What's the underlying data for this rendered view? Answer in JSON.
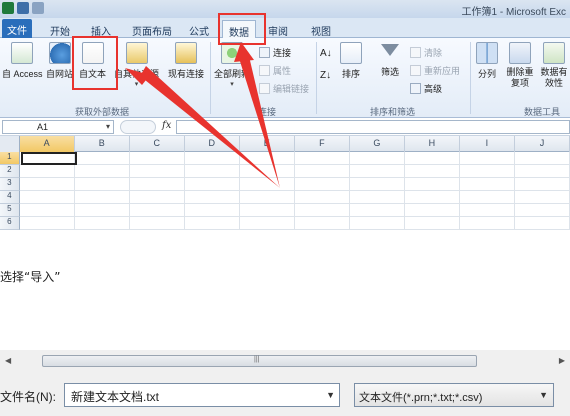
{
  "window": {
    "title": "工作簿1 - Microsoft Exc"
  },
  "tabs": {
    "file": "文件",
    "items": [
      "开始",
      "插入",
      "页面布局",
      "公式",
      "数据",
      "审阅",
      "视图"
    ],
    "active": "数据"
  },
  "ribbon": {
    "get_external": {
      "access": "自 Access",
      "web": "自网站",
      "text": "自文本",
      "other": "自其他来源",
      "existing": "现有连接",
      "label": "获取外部数据"
    },
    "connections": {
      "refresh_all": "全部刷新",
      "connections": "连接",
      "properties": "属性",
      "edit_links": "编辑链接",
      "label": "连接"
    },
    "sort_filter": {
      "sort": "排序",
      "filter": "筛选",
      "clear": "清除",
      "reapply": "重新应用",
      "advanced": "高级",
      "label": "排序和筛选"
    },
    "data_tools": {
      "split": "分列",
      "remove_dup": "删除重复项",
      "validation": "数据有效性",
      "label": "数据工具"
    }
  },
  "formula_bar": {
    "name_box": "A1",
    "fx": "fx",
    "content": ""
  },
  "grid": {
    "columns": [
      "A",
      "B",
      "C",
      "D",
      "E",
      "F",
      "G",
      "H",
      "I",
      "J"
    ],
    "rows": [
      "1",
      "2",
      "3",
      "4",
      "5",
      "6"
    ],
    "active_cell": "A1"
  },
  "caption": "选择“导入”",
  "dialog": {
    "filename_label": "文件名(N):",
    "filename_value": "新建文本文档.txt",
    "filetype_value": "文本文件(*.prn;*.txt;*.csv)"
  },
  "colors": {
    "annotation_red": "#e8332e",
    "file_tab": "#2a6ebb"
  }
}
